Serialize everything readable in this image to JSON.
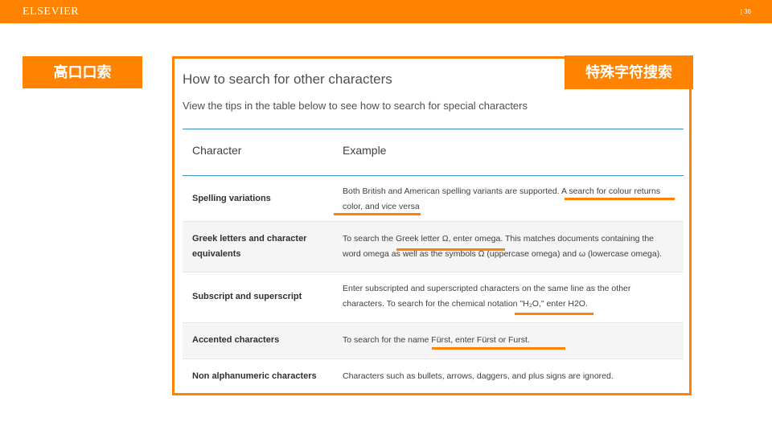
{
  "header": {
    "brand": "ELSEVIER",
    "page_number": "| 36"
  },
  "side_label": "高口口索",
  "callout": "特殊字符搜索",
  "panel": {
    "title": "How to search for other characters",
    "subtitle": "View the tips in the table below to see how to search for special characters",
    "columns": [
      "Character",
      "Example"
    ],
    "rows": [
      {
        "name": "Spelling variations",
        "example": "Both British and American spelling variants are supported. A search for colour returns color, and vice versa"
      },
      {
        "name": "Greek letters and character equivalents",
        "example": "To search the Greek letter Ω, enter omega. This matches documents containing the word omega as well as the symbols Ω (uppercase omega) and ω (lowercase omega)."
      },
      {
        "name": "Subscript and superscript",
        "example": "Enter subscripted and superscripted characters on the same line as the other characters. To search for the chemical notation \"H₂O,\" enter H2O."
      },
      {
        "name": "Accented characters",
        "example": "To search for the name Fürst, enter Fürst or Furst."
      },
      {
        "name": "Non alphanumeric characters",
        "example": "Characters such as bullets, arrows, daggers, and plus signs are ignored."
      }
    ]
  },
  "colors": {
    "accent": "#ff8200",
    "rule": "#3c8dc8"
  }
}
